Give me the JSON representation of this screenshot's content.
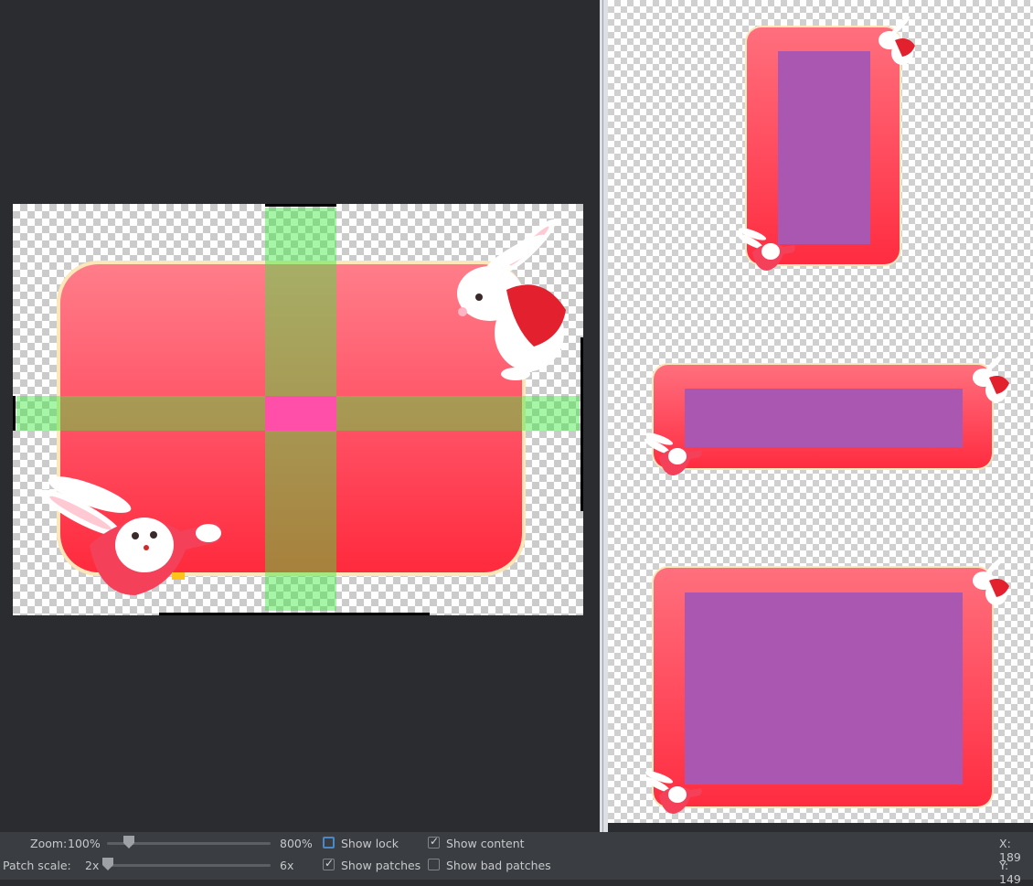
{
  "toolbar": {
    "zoom_label": "Zoom:",
    "zoom_value": "100%",
    "zoom_max": "800%",
    "patch_scale_label": "Patch scale:",
    "patch_scale_min": "2x",
    "patch_scale_max": "6x",
    "show_lock": {
      "label": "Show lock",
      "checked": false
    },
    "show_content": {
      "label": "Show content",
      "checked": true
    },
    "show_patches": {
      "label": "Show patches",
      "checked": true
    },
    "show_bad_patches": {
      "label": "Show bad patches",
      "checked": false
    },
    "x_readout": "X: 189",
    "y_readout": "Y: 149"
  },
  "colors": {
    "background": "#2b2c2f",
    "frame_fill": "#ff4f63",
    "frame_border": "#fde6b8",
    "patch_band": "#3ceb3c",
    "patch_cross": "#ff4fa8",
    "content_area": "#a957b0"
  },
  "icons": [
    "bunny-icon",
    "checkerboard-transparency"
  ]
}
